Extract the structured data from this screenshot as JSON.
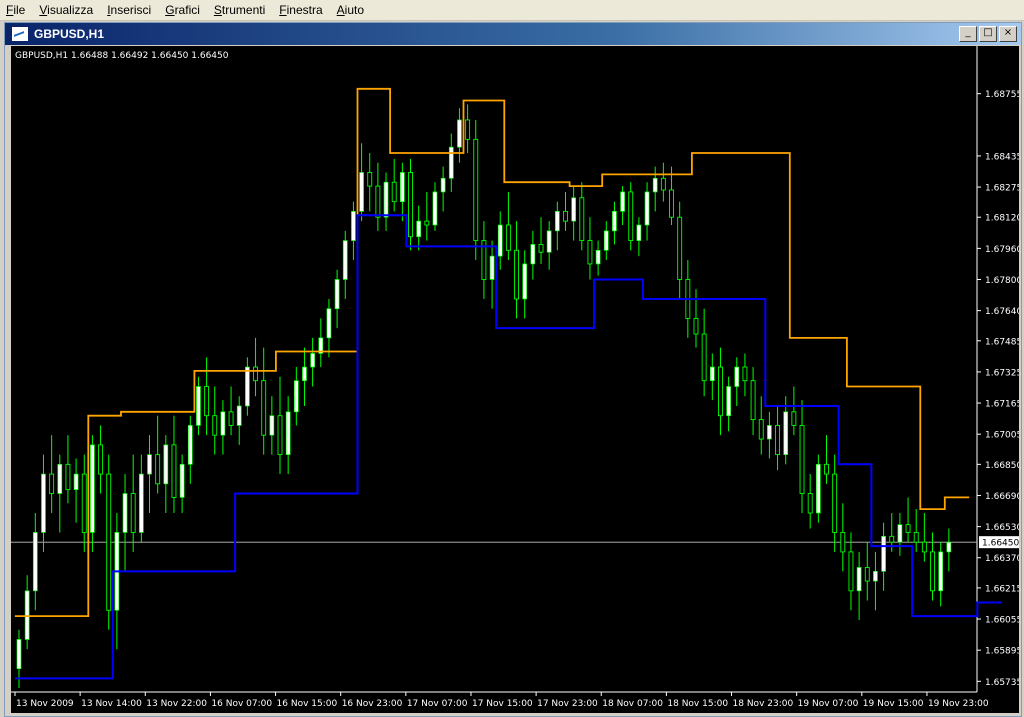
{
  "menu": [
    {
      "label": "File",
      "accel": "F"
    },
    {
      "label": "Visualizza",
      "accel": "V"
    },
    {
      "label": "Inserisci",
      "accel": "I"
    },
    {
      "label": "Grafici",
      "accel": "G"
    },
    {
      "label": "Strumenti",
      "accel": "S"
    },
    {
      "label": "Finestra",
      "accel": "F"
    },
    {
      "label": "Aiuto",
      "accel": "A"
    }
  ],
  "window": {
    "title": "GBPUSD,H1"
  },
  "colors": {
    "background": "#000000",
    "bull_body": "#ffffff",
    "candle_wick": "#00ff00",
    "upper_band": "#ffa500",
    "lower_band": "#0000ff",
    "bid_line": "#c0c0c0",
    "axis_text": "#ffffff"
  },
  "chart_data": {
    "type": "candlestick",
    "symbol": "GBPUSD,H1",
    "info_text": "GBPUSD,H1  1.66488 1.66492 1.66450 1.66450",
    "ylim": [
      1.6568,
      1.69
    ],
    "y_ticks": [
      "1.68755",
      "1.68435",
      "1.68275",
      "1.68120",
      "1.67960",
      "1.67800",
      "1.67640",
      "1.67485",
      "1.67325",
      "1.67165",
      "1.67005",
      "1.66850",
      "1.66690",
      "1.66530",
      "1.66370",
      "1.66215",
      "1.66055",
      "1.65895",
      "1.65735"
    ],
    "current_price": "1.66450",
    "x_ticks": [
      "13 Nov 2009",
      "13 Nov 14:00",
      "13 Nov 22:00",
      "16 Nov 07:00",
      "16 Nov 15:00",
      "16 Nov 23:00",
      "17 Nov 07:00",
      "17 Nov 15:00",
      "17 Nov 23:00",
      "18 Nov 07:00",
      "18 Nov 15:00",
      "18 Nov 23:00",
      "19 Nov 07:00",
      "19 Nov 15:00",
      "19 Nov 23:00"
    ],
    "candles": [
      [
        1.658,
        1.66,
        1.657,
        1.6595
      ],
      [
        1.6595,
        1.6628,
        1.659,
        1.662
      ],
      [
        1.662,
        1.666,
        1.661,
        1.665
      ],
      [
        1.665,
        1.669,
        1.664,
        1.668
      ],
      [
        1.668,
        1.67,
        1.666,
        1.667
      ],
      [
        1.667,
        1.669,
        1.665,
        1.6685
      ],
      [
        1.6685,
        1.67,
        1.6665,
        1.6672
      ],
      [
        1.6672,
        1.6688,
        1.6655,
        1.668
      ],
      [
        1.668,
        1.669,
        1.664,
        1.665
      ],
      [
        1.665,
        1.67,
        1.664,
        1.6695
      ],
      [
        1.6695,
        1.6705,
        1.667,
        1.668
      ],
      [
        1.668,
        1.669,
        1.66,
        1.661
      ],
      [
        1.661,
        1.666,
        1.659,
        1.665
      ],
      [
        1.665,
        1.668,
        1.663,
        1.667
      ],
      [
        1.667,
        1.669,
        1.664,
        1.665
      ],
      [
        1.665,
        1.669,
        1.6645,
        1.668
      ],
      [
        1.668,
        1.67,
        1.666,
        1.669
      ],
      [
        1.669,
        1.671,
        1.667,
        1.6675
      ],
      [
        1.6675,
        1.67,
        1.666,
        1.6695
      ],
      [
        1.6695,
        1.671,
        1.666,
        1.6668
      ],
      [
        1.6668,
        1.669,
        1.666,
        1.6685
      ],
      [
        1.6685,
        1.671,
        1.6675,
        1.6705
      ],
      [
        1.6705,
        1.673,
        1.67,
        1.6725
      ],
      [
        1.6725,
        1.674,
        1.67,
        1.671
      ],
      [
        1.671,
        1.6725,
        1.669,
        1.67
      ],
      [
        1.67,
        1.6718,
        1.669,
        1.6712
      ],
      [
        1.6712,
        1.6725,
        1.67,
        1.6705
      ],
      [
        1.6705,
        1.672,
        1.6695,
        1.6715
      ],
      [
        1.6715,
        1.674,
        1.671,
        1.6735
      ],
      [
        1.6735,
        1.675,
        1.672,
        1.6728
      ],
      [
        1.6728,
        1.6745,
        1.669,
        1.67
      ],
      [
        1.67,
        1.672,
        1.669,
        1.671
      ],
      [
        1.671,
        1.673,
        1.668,
        1.669
      ],
      [
        1.669,
        1.672,
        1.668,
        1.6712
      ],
      [
        1.6712,
        1.6735,
        1.6705,
        1.6728
      ],
      [
        1.6728,
        1.6745,
        1.6715,
        1.6735
      ],
      [
        1.6735,
        1.675,
        1.6725,
        1.6742
      ],
      [
        1.6742,
        1.676,
        1.6735,
        1.675
      ],
      [
        1.675,
        1.677,
        1.674,
        1.6765
      ],
      [
        1.6765,
        1.6785,
        1.6755,
        1.678
      ],
      [
        1.678,
        1.6805,
        1.677,
        1.68
      ],
      [
        1.68,
        1.682,
        1.679,
        1.6815
      ],
      [
        1.6815,
        1.685,
        1.681,
        1.6835
      ],
      [
        1.6835,
        1.6845,
        1.6815,
        1.6828
      ],
      [
        1.6828,
        1.684,
        1.6805,
        1.6812
      ],
      [
        1.6812,
        1.6835,
        1.6805,
        1.683
      ],
      [
        1.683,
        1.6842,
        1.6815,
        1.682
      ],
      [
        1.682,
        1.684,
        1.681,
        1.6835
      ],
      [
        1.6835,
        1.6842,
        1.6795,
        1.6802
      ],
      [
        1.6802,
        1.6818,
        1.6795,
        1.681
      ],
      [
        1.681,
        1.6825,
        1.68,
        1.6808
      ],
      [
        1.6808,
        1.683,
        1.6805,
        1.6825
      ],
      [
        1.6825,
        1.6838,
        1.6815,
        1.6832
      ],
      [
        1.6832,
        1.6855,
        1.6825,
        1.6848
      ],
      [
        1.6848,
        1.6868,
        1.684,
        1.6862
      ],
      [
        1.6862,
        1.687,
        1.6845,
        1.6852
      ],
      [
        1.6852,
        1.6862,
        1.679,
        1.68
      ],
      [
        1.68,
        1.681,
        1.677,
        1.678
      ],
      [
        1.678,
        1.68,
        1.6765,
        1.6792
      ],
      [
        1.6792,
        1.6815,
        1.6785,
        1.6808
      ],
      [
        1.6808,
        1.6825,
        1.679,
        1.6795
      ],
      [
        1.6795,
        1.681,
        1.676,
        1.677
      ],
      [
        1.677,
        1.6795,
        1.676,
        1.6788
      ],
      [
        1.6788,
        1.6805,
        1.678,
        1.6798
      ],
      [
        1.6798,
        1.6812,
        1.6788,
        1.6794
      ],
      [
        1.6794,
        1.681,
        1.6785,
        1.6805
      ],
      [
        1.6805,
        1.682,
        1.6795,
        1.6815
      ],
      [
        1.6815,
        1.6825,
        1.6805,
        1.681
      ],
      [
        1.681,
        1.6828,
        1.68,
        1.6822
      ],
      [
        1.6822,
        1.683,
        1.6795,
        1.68
      ],
      [
        1.68,
        1.6812,
        1.678,
        1.6788
      ],
      [
        1.6788,
        1.68,
        1.6782,
        1.6795
      ],
      [
        1.6795,
        1.681,
        1.679,
        1.6805
      ],
      [
        1.6805,
        1.682,
        1.6798,
        1.6815
      ],
      [
        1.6815,
        1.6828,
        1.6808,
        1.6825
      ],
      [
        1.6825,
        1.683,
        1.6795,
        1.68
      ],
      [
        1.68,
        1.6812,
        1.6792,
        1.6808
      ],
      [
        1.6808,
        1.683,
        1.68,
        1.6825
      ],
      [
        1.6825,
        1.6838,
        1.6815,
        1.6832
      ],
      [
        1.6832,
        1.684,
        1.682,
        1.6826
      ],
      [
        1.6826,
        1.6838,
        1.6808,
        1.6812
      ],
      [
        1.6812,
        1.682,
        1.677,
        1.678
      ],
      [
        1.678,
        1.679,
        1.675,
        1.676
      ],
      [
        1.676,
        1.6775,
        1.6745,
        1.6752
      ],
      [
        1.6752,
        1.6765,
        1.672,
        1.6728
      ],
      [
        1.6728,
        1.6742,
        1.6718,
        1.6735
      ],
      [
        1.6735,
        1.6745,
        1.67,
        1.671
      ],
      [
        1.671,
        1.673,
        1.6702,
        1.6725
      ],
      [
        1.6725,
        1.674,
        1.6715,
        1.6735
      ],
      [
        1.6735,
        1.6742,
        1.672,
        1.6728
      ],
      [
        1.6728,
        1.6735,
        1.67,
        1.6708
      ],
      [
        1.6708,
        1.672,
        1.669,
        1.6698
      ],
      [
        1.6698,
        1.6712,
        1.6688,
        1.6705
      ],
      [
        1.6705,
        1.6715,
        1.6682,
        1.669
      ],
      [
        1.669,
        1.672,
        1.6685,
        1.6712
      ],
      [
        1.6712,
        1.6725,
        1.67,
        1.6705
      ],
      [
        1.6705,
        1.6718,
        1.666,
        1.667
      ],
      [
        1.667,
        1.668,
        1.6652,
        1.666
      ],
      [
        1.666,
        1.669,
        1.6655,
        1.6685
      ],
      [
        1.6685,
        1.67,
        1.6675,
        1.668
      ],
      [
        1.668,
        1.669,
        1.664,
        1.665
      ],
      [
        1.665,
        1.6665,
        1.663,
        1.664
      ],
      [
        1.664,
        1.665,
        1.661,
        1.662
      ],
      [
        1.662,
        1.664,
        1.6605,
        1.6632
      ],
      [
        1.6632,
        1.6645,
        1.6615,
        1.6625
      ],
      [
        1.6625,
        1.664,
        1.661,
        1.663
      ],
      [
        1.663,
        1.6655,
        1.662,
        1.6648
      ],
      [
        1.6648,
        1.666,
        1.664,
        1.6645
      ],
      [
        1.6645,
        1.666,
        1.6638,
        1.6654
      ],
      [
        1.6654,
        1.6668,
        1.6645,
        1.665
      ],
      [
        1.665,
        1.6662,
        1.664,
        1.6645
      ],
      [
        1.6645,
        1.666,
        1.6635,
        1.664
      ],
      [
        1.664,
        1.665,
        1.6615,
        1.662
      ],
      [
        1.662,
        1.6645,
        1.6612,
        1.664
      ],
      [
        1.664,
        1.6652,
        1.663,
        1.6645
      ]
    ],
    "upper_band": [
      1.6607,
      1.6607,
      1.6607,
      1.6607,
      1.6607,
      1.6607,
      1.6607,
      1.6607,
      1.6607,
      1.671,
      1.671,
      1.671,
      1.671,
      1.6712,
      1.6712,
      1.6712,
      1.6712,
      1.6712,
      1.6712,
      1.6712,
      1.6712,
      1.6712,
      1.6733,
      1.6733,
      1.6733,
      1.6733,
      1.6733,
      1.6733,
      1.6733,
      1.6733,
      1.6733,
      1.6733,
      1.6743,
      1.6743,
      1.6743,
      1.6743,
      1.6743,
      1.6743,
      1.6743,
      1.6743,
      1.6743,
      1.6743,
      1.6878,
      1.6878,
      1.6878,
      1.6878,
      1.6845,
      1.6845,
      1.6845,
      1.6845,
      1.6845,
      1.6845,
      1.6845,
      1.6845,
      1.6845,
      1.6872,
      1.6872,
      1.6872,
      1.6872,
      1.6872,
      1.683,
      1.683,
      1.683,
      1.683,
      1.683,
      1.683,
      1.683,
      1.683,
      1.6828,
      1.6828,
      1.6828,
      1.6828,
      1.6834,
      1.6834,
      1.6834,
      1.6834,
      1.6834,
      1.6834,
      1.6834,
      1.6834,
      1.6834,
      1.6834,
      1.6834,
      1.6845,
      1.6845,
      1.6845,
      1.6845,
      1.6845,
      1.6845,
      1.6845,
      1.6845,
      1.6845,
      1.6845,
      1.6845,
      1.6845,
      1.675,
      1.675,
      1.675,
      1.675,
      1.675,
      1.675,
      1.675,
      1.6725,
      1.6725,
      1.6725,
      1.6725,
      1.6725,
      1.6725,
      1.6725,
      1.6725,
      1.6725,
      1.6662,
      1.6662,
      1.6662,
      1.6668,
      1.6668,
      1.6668
    ],
    "lower_band": [
      1.6575,
      1.6575,
      1.6575,
      1.6575,
      1.6575,
      1.6575,
      1.6575,
      1.6575,
      1.6575,
      1.6575,
      1.6575,
      1.6575,
      1.663,
      1.663,
      1.663,
      1.663,
      1.663,
      1.663,
      1.663,
      1.663,
      1.663,
      1.663,
      1.663,
      1.663,
      1.663,
      1.663,
      1.663,
      1.667,
      1.667,
      1.667,
      1.667,
      1.667,
      1.667,
      1.667,
      1.667,
      1.667,
      1.667,
      1.667,
      1.667,
      1.667,
      1.667,
      1.667,
      1.6813,
      1.6813,
      1.6813,
      1.6813,
      1.6813,
      1.6813,
      1.6797,
      1.6797,
      1.6797,
      1.6797,
      1.6797,
      1.6797,
      1.6797,
      1.6797,
      1.6797,
      1.6797,
      1.6797,
      1.6755,
      1.6755,
      1.6755,
      1.6755,
      1.6755,
      1.6755,
      1.6755,
      1.6755,
      1.6755,
      1.6755,
      1.6755,
      1.6755,
      1.678,
      1.678,
      1.678,
      1.678,
      1.678,
      1.678,
      1.677,
      1.677,
      1.677,
      1.677,
      1.677,
      1.677,
      1.677,
      1.677,
      1.677,
      1.677,
      1.677,
      1.677,
      1.677,
      1.677,
      1.677,
      1.6715,
      1.6715,
      1.6715,
      1.6715,
      1.6715,
      1.6715,
      1.6715,
      1.6715,
      1.6715,
      1.6685,
      1.6685,
      1.6685,
      1.6685,
      1.6643,
      1.6643,
      1.6643,
      1.6643,
      1.6643,
      1.6607,
      1.6607,
      1.6607,
      1.6607,
      1.6607,
      1.6607,
      1.6607,
      1.6607,
      1.6614,
      1.6614,
      1.6614
    ]
  }
}
